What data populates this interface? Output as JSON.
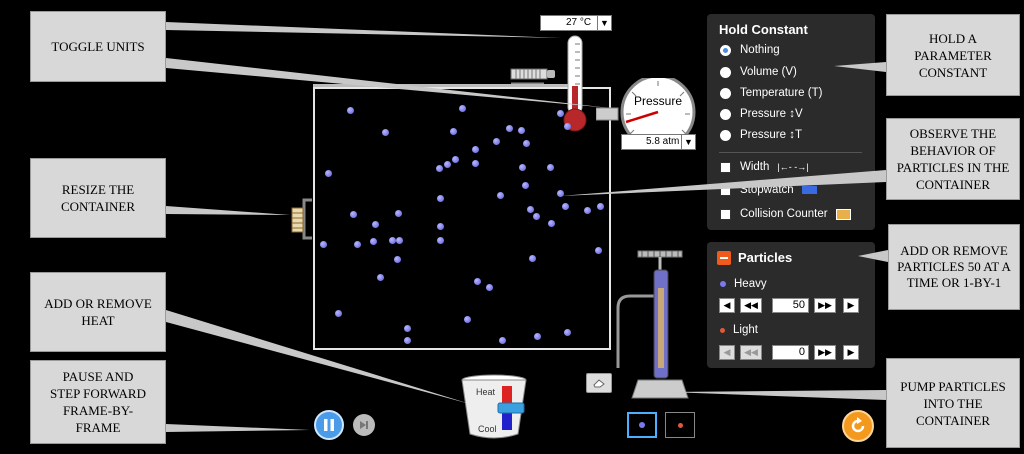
{
  "callouts": {
    "toggle_units": "TOGGLE UNITS",
    "resize_container": "RESIZE THE CONTAINER",
    "add_remove_heat": "ADD OR REMOVE HEAT",
    "pause_step": "PAUSE AND STEP FORWARD FRAME-BY-FRAME",
    "hold_parameter": "HOLD A PARAMETER CONSTANT",
    "observe_behavior": "OBSERVE THE BEHAVIOR OF PARTICLES IN THE CONTAINER",
    "add_remove_particles": "ADD OR REMOVE PARTICLES 50 AT A TIME OR 1-BY-1",
    "pump_particles": "PUMP PARTICLES INTO THE CONTAINER"
  },
  "thermometer": {
    "value": "27 °C"
  },
  "gauge": {
    "label": "Pressure",
    "value": "5.8 atm"
  },
  "heater": {
    "heat_label": "Heat",
    "cool_label": "Cool"
  },
  "hold_constant": {
    "title": "Hold Constant",
    "options": [
      {
        "label": "Nothing",
        "selected": true
      },
      {
        "label": "Volume (V)",
        "selected": false
      },
      {
        "label": "Temperature (T)",
        "selected": false
      },
      {
        "label": "Pressure ↕V",
        "selected": false
      },
      {
        "label": "Pressure ↕T",
        "selected": false
      }
    ],
    "checks": [
      {
        "label": "Width",
        "extra": "|←- -→|"
      },
      {
        "label": "Stopwatch"
      },
      {
        "label": "Collision Counter"
      }
    ]
  },
  "particles": {
    "title": "Particles",
    "heavy": {
      "label": "Heavy",
      "count": "50"
    },
    "light": {
      "label": "Light",
      "count": "0"
    }
  },
  "colors": {
    "heavy_particle": "#7a7aee",
    "light_particle": "#e05a3a",
    "reset_button": "#f39a1e",
    "play_button": "#4a9be8"
  }
}
